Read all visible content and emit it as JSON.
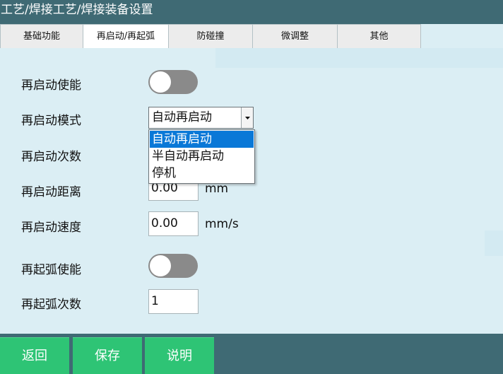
{
  "window": {
    "title": "工艺/焊接工艺/焊接装备设置"
  },
  "tabs": [
    {
      "label": "基础功能",
      "active": false
    },
    {
      "label": "再启动/再起弧",
      "active": true
    },
    {
      "label": "防碰撞",
      "active": false
    },
    {
      "label": "微调整",
      "active": false
    },
    {
      "label": "其他",
      "active": false
    }
  ],
  "form": {
    "restart_enable": {
      "label": "再启动使能",
      "value": false
    },
    "restart_mode": {
      "label": "再启动模式",
      "selected": "自动再启动",
      "dropdown_open": true,
      "options": [
        "自动再启动",
        "半自动再启动",
        "停机"
      ],
      "selected_index": 0
    },
    "restart_count": {
      "label": "再启动次数"
    },
    "restart_distance": {
      "label": "再启动距离",
      "value": "0.00",
      "unit": "mm"
    },
    "restart_speed": {
      "label": "再启动速度",
      "value": "0.00",
      "unit": "mm/s"
    },
    "rearc_enable": {
      "label": "再起弧使能",
      "value": false
    },
    "rearc_count": {
      "label": "再起弧次数",
      "value": "1"
    }
  },
  "footer": {
    "back_label": "返回",
    "save_label": "保存",
    "help_label": "说明"
  },
  "colors": {
    "title_bar": "#3f6a74",
    "panel": "#dbeef4",
    "toggle_off": "#8a8a8a",
    "button_green": "#2ec475",
    "selection_blue": "#0a78d7"
  }
}
